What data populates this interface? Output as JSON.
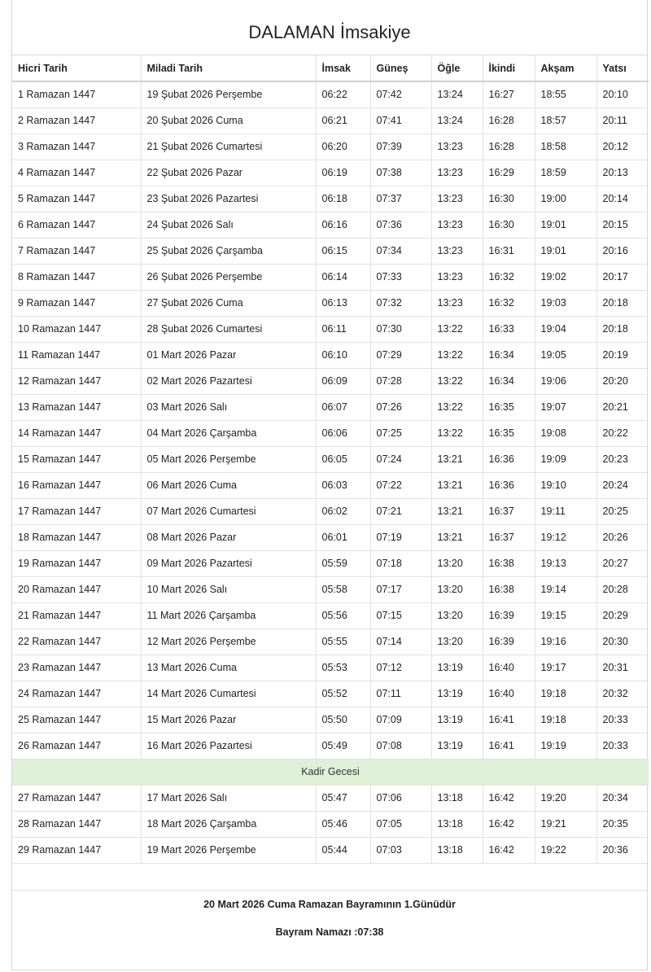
{
  "title": "DALAMAN İmsakiye",
  "headers": [
    "Hicri Tarih",
    "Miladi Tarih",
    "İmsak",
    "Güneş",
    "Öğle",
    "İkindi",
    "Akşam",
    "Yatsı"
  ],
  "rows": [
    [
      "1 Ramazan 1447",
      "19 Şubat 2026 Perşembe",
      "06:22",
      "07:42",
      "13:24",
      "16:27",
      "18:55",
      "20:10"
    ],
    [
      "2 Ramazan 1447",
      "20 Şubat 2026 Cuma",
      "06:21",
      "07:41",
      "13:24",
      "16:28",
      "18:57",
      "20:11"
    ],
    [
      "3 Ramazan 1447",
      "21 Şubat 2026 Cumartesi",
      "06:20",
      "07:39",
      "13:23",
      "16:28",
      "18:58",
      "20:12"
    ],
    [
      "4 Ramazan 1447",
      "22 Şubat 2026 Pazar",
      "06:19",
      "07:38",
      "13:23",
      "16:29",
      "18:59",
      "20:13"
    ],
    [
      "5 Ramazan 1447",
      "23 Şubat 2026 Pazartesi",
      "06:18",
      "07:37",
      "13:23",
      "16:30",
      "19:00",
      "20:14"
    ],
    [
      "6 Ramazan 1447",
      "24 Şubat 2026 Salı",
      "06:16",
      "07:36",
      "13:23",
      "16:30",
      "19:01",
      "20:15"
    ],
    [
      "7 Ramazan 1447",
      "25 Şubat 2026 Çarşamba",
      "06:15",
      "07:34",
      "13:23",
      "16:31",
      "19:01",
      "20:16"
    ],
    [
      "8 Ramazan 1447",
      "26 Şubat 2026 Perşembe",
      "06:14",
      "07:33",
      "13:23",
      "16:32",
      "19:02",
      "20:17"
    ],
    [
      "9 Ramazan 1447",
      "27 Şubat 2026 Cuma",
      "06:13",
      "07:32",
      "13:23",
      "16:32",
      "19:03",
      "20:18"
    ],
    [
      "10 Ramazan 1447",
      "28 Şubat 2026 Cumartesi",
      "06:11",
      "07:30",
      "13:22",
      "16:33",
      "19:04",
      "20:18"
    ],
    [
      "11 Ramazan 1447",
      "01 Mart 2026 Pazar",
      "06:10",
      "07:29",
      "13:22",
      "16:34",
      "19:05",
      "20:19"
    ],
    [
      "12 Ramazan 1447",
      "02 Mart 2026 Pazartesi",
      "06:09",
      "07:28",
      "13:22",
      "16:34",
      "19:06",
      "20:20"
    ],
    [
      "13 Ramazan 1447",
      "03 Mart 2026 Salı",
      "06:07",
      "07:26",
      "13:22",
      "16:35",
      "19:07",
      "20:21"
    ],
    [
      "14 Ramazan 1447",
      "04 Mart 2026 Çarşamba",
      "06:06",
      "07:25",
      "13:22",
      "16:35",
      "19:08",
      "20:22"
    ],
    [
      "15 Ramazan 1447",
      "05 Mart 2026 Perşembe",
      "06:05",
      "07:24",
      "13:21",
      "16:36",
      "19:09",
      "20:23"
    ],
    [
      "16 Ramazan 1447",
      "06 Mart 2026 Cuma",
      "06:03",
      "07:22",
      "13:21",
      "16:36",
      "19:10",
      "20:24"
    ],
    [
      "17 Ramazan 1447",
      "07 Mart 2026 Cumartesi",
      "06:02",
      "07:21",
      "13:21",
      "16:37",
      "19:11",
      "20:25"
    ],
    [
      "18 Ramazan 1447",
      "08 Mart 2026 Pazar",
      "06:01",
      "07:19",
      "13:21",
      "16:37",
      "19:12",
      "20:26"
    ],
    [
      "19 Ramazan 1447",
      "09 Mart 2026 Pazartesi",
      "05:59",
      "07:18",
      "13:20",
      "16:38",
      "19:13",
      "20:27"
    ],
    [
      "20 Ramazan 1447",
      "10 Mart 2026 Salı",
      "05:58",
      "07:17",
      "13:20",
      "16:38",
      "19:14",
      "20:28"
    ],
    [
      "21 Ramazan 1447",
      "11 Mart 2026 Çarşamba",
      "05:56",
      "07:15",
      "13:20",
      "16:39",
      "19:15",
      "20:29"
    ],
    [
      "22 Ramazan 1447",
      "12 Mart 2026 Perşembe",
      "05:55",
      "07:14",
      "13:20",
      "16:39",
      "19:16",
      "20:30"
    ],
    [
      "23 Ramazan 1447",
      "13 Mart 2026 Cuma",
      "05:53",
      "07:12",
      "13:19",
      "16:40",
      "19:17",
      "20:31"
    ],
    [
      "24 Ramazan 1447",
      "14 Mart 2026 Cumartesi",
      "05:52",
      "07:11",
      "13:19",
      "16:40",
      "19:18",
      "20:32"
    ],
    [
      "25 Ramazan 1447",
      "15 Mart 2026 Pazar",
      "05:50",
      "07:09",
      "13:19",
      "16:41",
      "19:18",
      "20:33"
    ],
    [
      "26 Ramazan 1447",
      "16 Mart 2026 Pazartesi",
      "05:49",
      "07:08",
      "13:19",
      "16:41",
      "19:19",
      "20:33"
    ]
  ],
  "special_row": "Kadir Gecesi",
  "special_row_color": "#dff0d8",
  "rows_after": [
    [
      "27 Ramazan 1447",
      "17 Mart 2026 Salı",
      "05:47",
      "07:06",
      "13:18",
      "16:42",
      "19:20",
      "20:34"
    ],
    [
      "28 Ramazan 1447",
      "18 Mart 2026 Çarşamba",
      "05:46",
      "07:05",
      "13:18",
      "16:42",
      "19:21",
      "20:35"
    ],
    [
      "29 Ramazan 1447",
      "19 Mart 2026 Perşembe",
      "05:44",
      "07:03",
      "13:18",
      "16:42",
      "19:22",
      "20:36"
    ]
  ],
  "footer": {
    "bayram_text": "20 Mart 2026 Cuma Ramazan Bayramının 1.Günüdür",
    "bayram_namazi": "Bayram Namazı :07:38"
  }
}
